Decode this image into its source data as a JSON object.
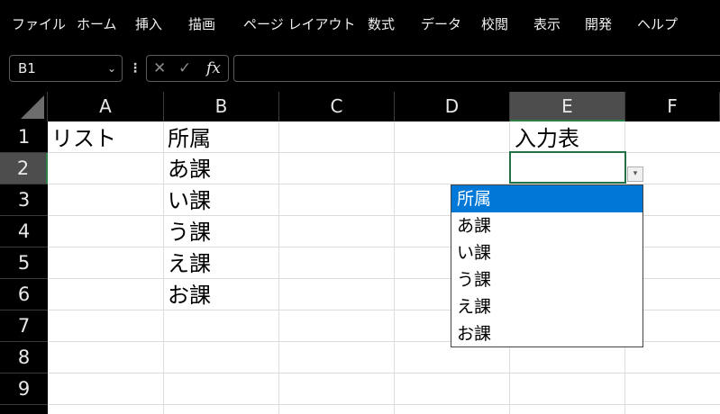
{
  "menu": [
    "ファイル",
    "ホーム",
    "挿入",
    "描画",
    "ページ レイアウト",
    "数式",
    "データ",
    "校閲",
    "表示",
    "開発",
    "ヘルプ"
  ],
  "formula_bar": {
    "name_box": "B1",
    "cancel_icon": "✕",
    "enter_icon": "✓",
    "fx_label": "fx",
    "formula": ""
  },
  "columns": [
    "A",
    "B",
    "C",
    "D",
    "E",
    "F"
  ],
  "selected_column": "E",
  "rows": [
    "1",
    "2",
    "3",
    "4",
    "5",
    "6",
    "7",
    "8",
    "9"
  ],
  "selected_row": "2",
  "cells": {
    "A1": "リスト",
    "B1": "所属",
    "B2": "あ課",
    "B3": "い課",
    "B4": "う課",
    "B5": "え課",
    "B6": "お課",
    "E1": "入力表",
    "E2": ""
  },
  "active_cell": "E2",
  "dropdown": {
    "icon": "chevron-down-icon",
    "options": [
      "所属",
      "あ課",
      "い課",
      "う課",
      "え課",
      "お課"
    ],
    "highlighted_index": 0
  },
  "colors": {
    "selection_border": "#217346",
    "highlight": "#0078d7",
    "header_bg": "#000000",
    "selected_header_bg": "#4d4d4d"
  }
}
